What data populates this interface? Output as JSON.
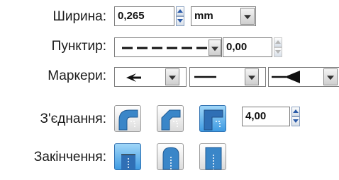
{
  "labels": {
    "width": "Ширина:",
    "dash": "Пунктир:",
    "markers": "Маркери:",
    "joins": "З'єднання:",
    "caps": "Закінчення:"
  },
  "width": {
    "value": "0,265",
    "unit": "mm"
  },
  "dash": {
    "pattern": "dashed",
    "offset": "0,00"
  },
  "markers": {
    "start": "arrow-start-marker",
    "mid": "line-mid-marker",
    "end": "arrow-end-marker"
  },
  "joins": {
    "options": [
      "round-join-icon",
      "bevel-join-icon",
      "miter-join-icon"
    ],
    "selected": 2,
    "miter_limit": "4,00"
  },
  "caps": {
    "options": [
      "butt-cap-icon",
      "round-cap-icon",
      "square-cap-icon"
    ],
    "selected": 0
  },
  "colors": {
    "accent": "#3f9be2",
    "accent_light": "#9fd6f8",
    "shape_blue": "#2f6fb5"
  }
}
